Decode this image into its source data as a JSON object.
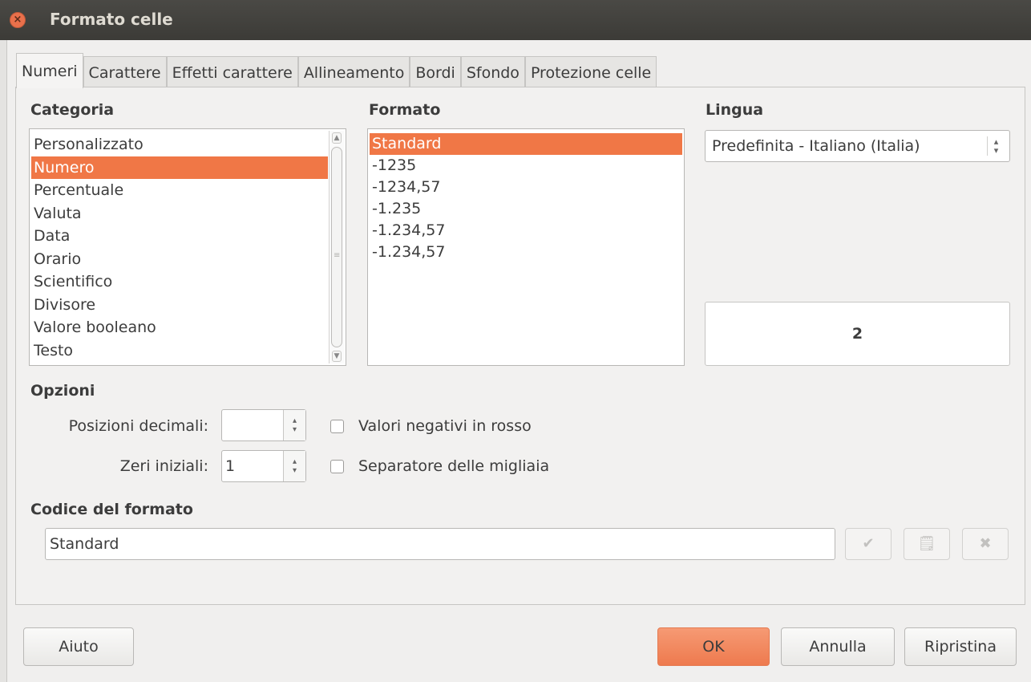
{
  "window": {
    "title": "Formato celle",
    "close_icon": "close-icon"
  },
  "tabs": [
    {
      "label": "Numeri",
      "active": true
    },
    {
      "label": "Carattere"
    },
    {
      "label": "Effetti carattere"
    },
    {
      "label": "Allineamento"
    },
    {
      "label": "Bordi"
    },
    {
      "label": "Sfondo"
    },
    {
      "label": "Protezione celle"
    }
  ],
  "category": {
    "label": "Categoria",
    "items": [
      "Personalizzato",
      "Numero",
      "Percentuale",
      "Valuta",
      "Data",
      "Orario",
      "Scientifico",
      "Divisore",
      "Valore booleano",
      "Testo"
    ],
    "selected": "Numero"
  },
  "format": {
    "label": "Formato",
    "items": [
      "Standard",
      "-1235",
      "-1234,57",
      "-1.235",
      "-1.234,57",
      "-1.234,57"
    ],
    "selected": "Standard"
  },
  "language": {
    "label": "Lingua",
    "value": "Predefinita - Italiano (Italia)"
  },
  "preview": {
    "value": "2"
  },
  "options": {
    "label": "Opzioni",
    "decimal_label": "Posizioni decimali:",
    "decimal_value": "",
    "leading_zeros_label": "Zeri iniziali:",
    "leading_zeros_value": "1",
    "negative_red_label": "Valori negativi in rosso",
    "negative_red_checked": false,
    "thousands_sep_label": "Separatore delle migliaia",
    "thousands_sep_checked": false
  },
  "format_code": {
    "label": "Codice del formato",
    "value": "Standard",
    "icons": [
      "checkmark-icon",
      "edit-comment-icon",
      "delete-icon"
    ]
  },
  "buttons": {
    "help": "Aiuto",
    "ok": "OK",
    "cancel": "Annulla",
    "reset": "Ripristina"
  },
  "colors": {
    "accent": "#f07746",
    "titlebar": "#3c3b37"
  }
}
